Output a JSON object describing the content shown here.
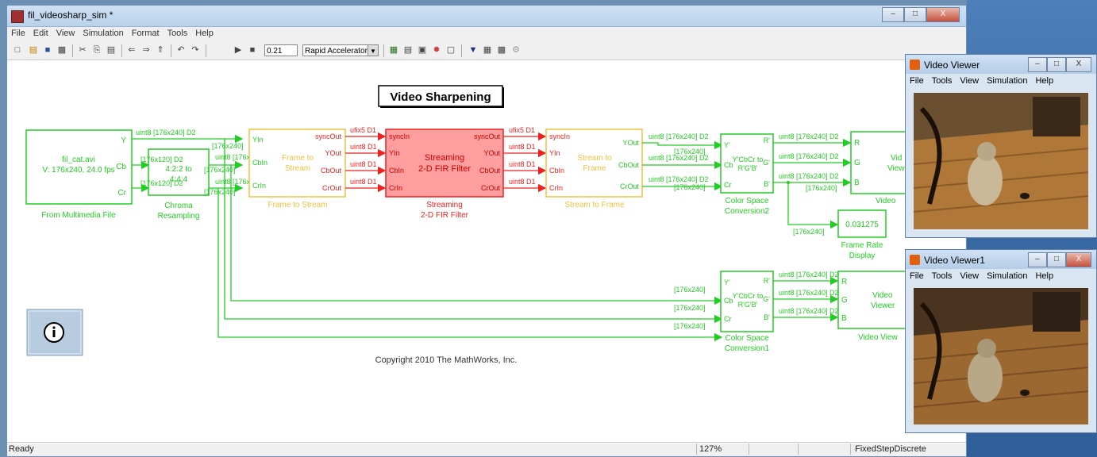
{
  "window": {
    "title": "fil_videosharp_sim *"
  },
  "menu": [
    "File",
    "Edit",
    "View",
    "Simulation",
    "Format",
    "Tools",
    "Help"
  ],
  "toolbar": {
    "stop_time": "0.21",
    "sim_mode": "Rapid Accelerator"
  },
  "diagram": {
    "title": "Video Sharpening",
    "copyright": "Copyright 2010 The MathWorks, Inc.",
    "source": {
      "line1": "fil_cat.avi",
      "line2": "V: 176x240, 24.0 fps",
      "label": "From Multimedia File",
      "ports": [
        "Y",
        "Cb",
        "Cr"
      ]
    },
    "chroma": {
      "text1": "4:2:2 to",
      "text2": "4:4:4",
      "label1": "Chroma",
      "label2": "Resampling"
    },
    "f2s": {
      "label": "Frame to Stream",
      "inner1": "Frame to",
      "inner2": "Stream",
      "in": [
        "YIn",
        "CbIn",
        "CrIn"
      ],
      "out": [
        "syncOut",
        "YOut",
        "CbOut",
        "CrOut"
      ]
    },
    "fir": {
      "inner1": "Streaming",
      "inner2": "2-D FIR Filter",
      "label1": "Streaming",
      "label2": "2-D FIR Filter",
      "in": [
        "syncIn",
        "YIn",
        "CbIn",
        "CrIn"
      ],
      "out": [
        "syncOut",
        "YOut",
        "CbOut",
        "CrOut"
      ]
    },
    "s2f": {
      "label": "Stream to Frame",
      "inner1": "Stream to",
      "inner2": "Frame",
      "in": [
        "syncIn",
        "YIn",
        "CbIn",
        "CrIn"
      ],
      "out": [
        "YOut",
        "CbOut",
        "CrOut"
      ]
    },
    "csc2": {
      "label1": "Color Space",
      "label2": "Conversion2",
      "in": [
        "Y'",
        "Cb",
        "Cr"
      ],
      "out": [
        "R'",
        "G'",
        "B'"
      ],
      "inner": "Y'CbCr to",
      "inner2": "R'G'B'"
    },
    "csc1": {
      "label1": "Color Space",
      "label2": "Conversion1",
      "in": [
        "Y'",
        "Cb",
        "Cr"
      ],
      "out": [
        "R'",
        "G'",
        "B'"
      ],
      "inner": "Y'CbCr to",
      "inner2": "R'G'B'"
    },
    "viewer_top": {
      "text": "Vid",
      "text2": "View",
      "label": "Video",
      "ports": [
        "R",
        "G",
        "B"
      ]
    },
    "viewer_bot": {
      "text": "Video",
      "text2": "Viewer",
      "label": "Video View",
      "ports": [
        "R",
        "G",
        "B"
      ]
    },
    "fr": {
      "value": "0.031275",
      "label1": "Frame Rate",
      "label2": "Display"
    },
    "sig": {
      "u8d2": "uint8 [176x240] D2",
      "u8120": "[176x120] D2",
      "s176": "[176x240]",
      "s176d2": "[176x240] D2",
      "ufix": "ufix5 D1",
      "u8d1": "uint8 D1"
    }
  },
  "status": {
    "left": "Ready",
    "zoom": "127%",
    "solver": "FixedStepDiscrete"
  },
  "viewer1": {
    "title": "Video Viewer",
    "menu": [
      "File",
      "Tools",
      "View",
      "Simulation",
      "Help"
    ]
  },
  "viewer2": {
    "title": "Video Viewer1",
    "menu": [
      "File",
      "Tools",
      "View",
      "Simulation",
      "Help"
    ]
  },
  "colors": {
    "green": "#22cc22",
    "yellow": "#f0c040",
    "red": "#ee2020",
    "redfill": "#ff9e9e"
  }
}
